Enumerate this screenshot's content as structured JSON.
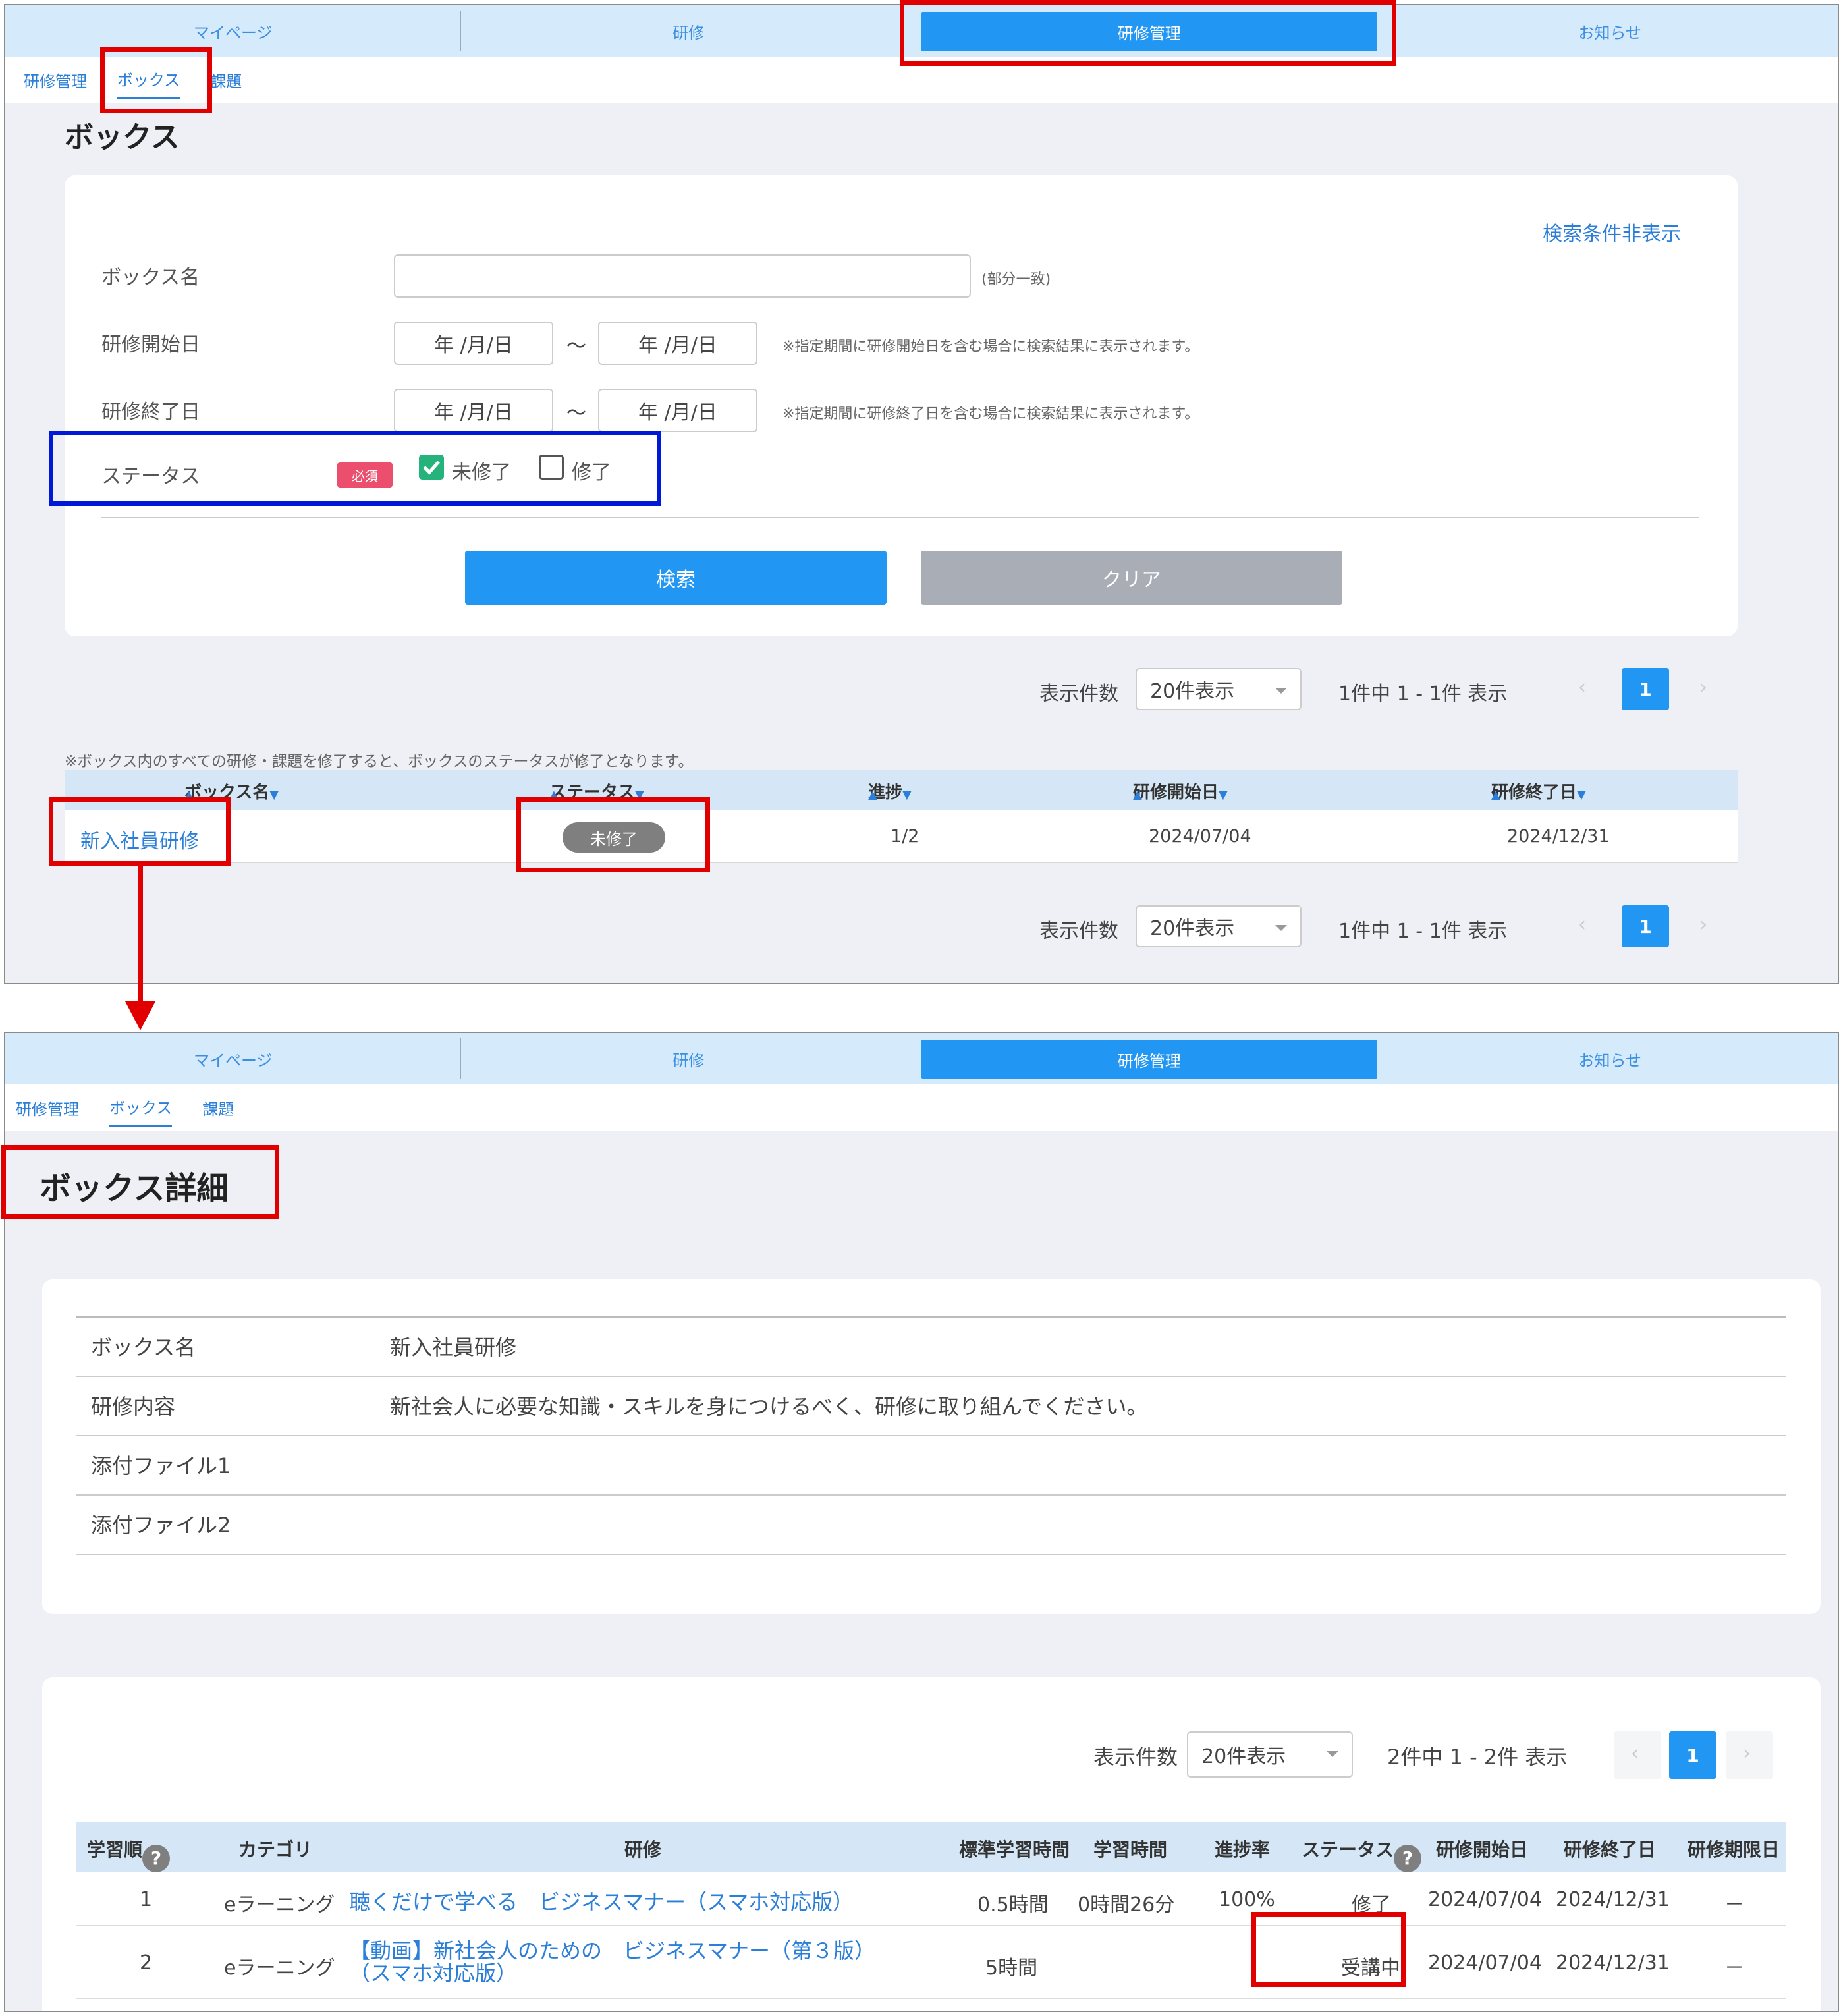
{
  "nav": {
    "tabs": [
      "マイページ",
      "研修",
      "研修管理",
      "お知らせ"
    ],
    "active_index": 2
  },
  "subnav": {
    "items": [
      "研修管理",
      "ボックス",
      "課題"
    ],
    "current": "ボックス"
  },
  "box_list": {
    "title": "ボックス",
    "toggle_search": "検索条件非表示",
    "labels": {
      "name": "ボックス名",
      "start": "研修開始日",
      "end": "研修終了日",
      "status": "ステータス"
    },
    "partial_match": "(部分一致)",
    "date_placeholder": "年 /月/日",
    "tilde": "～",
    "start_note": "※指定期間に研修開始日を含む場合に検索結果に表示されます。",
    "end_note": "※指定期間に研修終了日を含む場合に検索結果に表示されます。",
    "required": "必須",
    "status_options": [
      {
        "label": "未修了",
        "checked": true
      },
      {
        "label": "修了",
        "checked": false
      }
    ],
    "search_button": "検索",
    "clear_button": "クリア",
    "per_page_label": "表示件数",
    "per_page_value": "20件表示",
    "range_text": "1件中 1 - 1件 表示",
    "page": "1",
    "note": "※ボックス内のすべての研修・課題を修了すると、ボックスのステータスが修了となります。",
    "columns": [
      "ボックス名",
      "ステータス",
      "進捗",
      "研修開始日",
      "研修終了日"
    ],
    "rows": [
      {
        "name": "新入社員研修",
        "status": "未修了",
        "progress": "1/2",
        "start": "2024/07/04",
        "end": "2024/12/31"
      }
    ]
  },
  "box_detail": {
    "title": "ボックス詳細",
    "info": [
      {
        "label": "ボックス名",
        "value": "新入社員研修"
      },
      {
        "label": "研修内容",
        "value": "新社会人に必要な知識・スキルを身につけるべく、研修に取り組んでください。"
      },
      {
        "label": "添付ファイル1",
        "value": ""
      },
      {
        "label": "添付ファイル2",
        "value": ""
      }
    ],
    "per_page_label": "表示件数",
    "per_page_value": "20件表示",
    "range_text": "2件中 1 - 2件 表示",
    "page": "1",
    "columns": [
      "学習順",
      "カテゴリ",
      "研修",
      "標準学習時間",
      "学習時間",
      "進捗率",
      "ステータス",
      "研修開始日",
      "研修終了日",
      "研修期限日"
    ],
    "rows": [
      {
        "order": "1",
        "category": "eラーニング",
        "title": "聴くだけで学べる　ビジネスマナー（スマホ対応版）",
        "title2": "",
        "std_time": "0.5時間",
        "time": "0時間26分",
        "rate": "100%",
        "status": "修了",
        "start": "2024/07/04",
        "end": "2024/12/31",
        "deadline": "－"
      },
      {
        "order": "2",
        "category": "eラーニング",
        "title": "【動画】新社会人のための　ビジネスマナー（第３版）",
        "title2": "（スマホ対応版）",
        "std_time": "5時間",
        "time": "",
        "rate": "",
        "status": "受講中",
        "start": "2024/07/04",
        "end": "2024/12/31",
        "deadline": "－"
      }
    ]
  },
  "colors": {
    "accent": "#2196f3",
    "highlight_red": "#e00000",
    "highlight_blue": "#0018d8"
  }
}
